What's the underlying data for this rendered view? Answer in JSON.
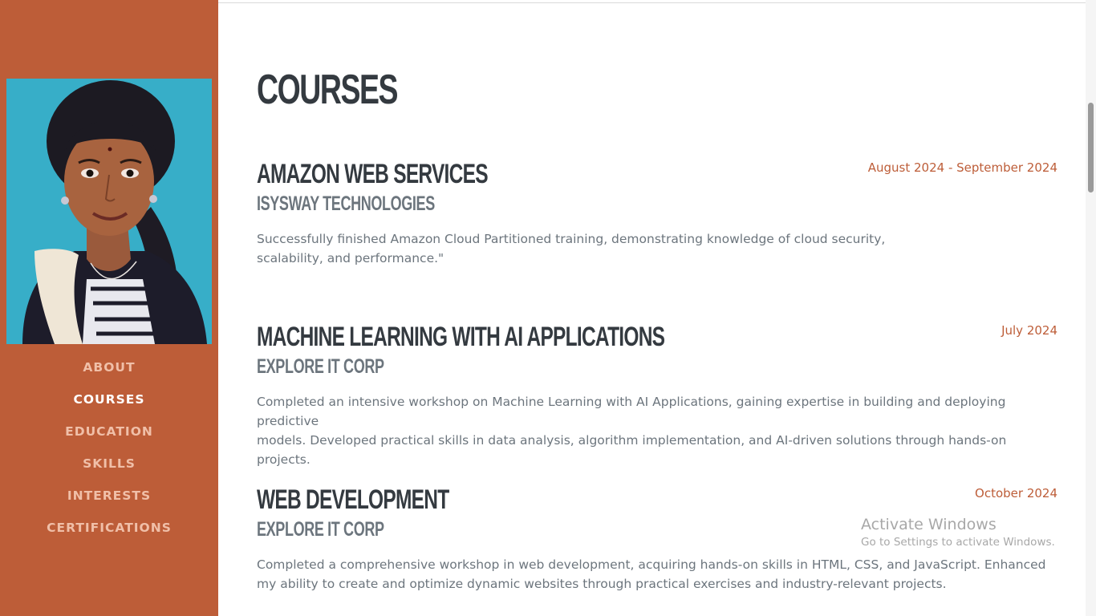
{
  "sidebar": {
    "nav": [
      {
        "label": "ABOUT",
        "active": false
      },
      {
        "label": "COURSES",
        "active": true
      },
      {
        "label": "EDUCATION",
        "active": false
      },
      {
        "label": "SKILLS",
        "active": false
      },
      {
        "label": "INTERESTS",
        "active": false
      },
      {
        "label": "CERTIFICATIONS",
        "active": false
      }
    ]
  },
  "main": {
    "title": "COURSES",
    "courses": [
      {
        "title": "AMAZON WEB SERVICES",
        "org": "ISYSWAY TECHNOLOGIES",
        "date": "August 2024 - September 2024",
        "desc_lines": [
          "Successfully finished Amazon Cloud Partitioned training, demonstrating knowledge of cloud security,",
          "scalability, and performance.\""
        ]
      },
      {
        "title": "MACHINE LEARNING WITH AI APPLICATIONS",
        "org": "EXPLORE IT CORP",
        "date": "July 2024",
        "desc_lines": [
          "Completed an intensive workshop on Machine Learning with AI Applications, gaining expertise in building and deploying predictive",
          "models. Developed practical skills in data analysis, algorithm implementation, and AI-driven solutions through hands-on projects."
        ]
      },
      {
        "title": "WEB DEVELOPMENT",
        "org": "EXPLORE IT CORP",
        "date": "October 2024",
        "desc_lines": [
          "Completed a comprehensive workshop in web development, acquiring hands-on skills in HTML, CSS, and JavaScript. Enhanced",
          "my ability to create and optimize dynamic websites through practical exercises and industry-relevant projects."
        ]
      }
    ]
  },
  "watermark": {
    "title": "Activate Windows",
    "subtitle": "Go to Settings to activate Windows."
  },
  "colors": {
    "sidebar_bg": "#bd5d38",
    "nav_text": "#f0bfa8",
    "nav_active": "#ffffff",
    "heading": "#343a40",
    "muted": "#6c757d",
    "accent": "#bd5d38"
  },
  "icons": [
    "profile-photo"
  ]
}
